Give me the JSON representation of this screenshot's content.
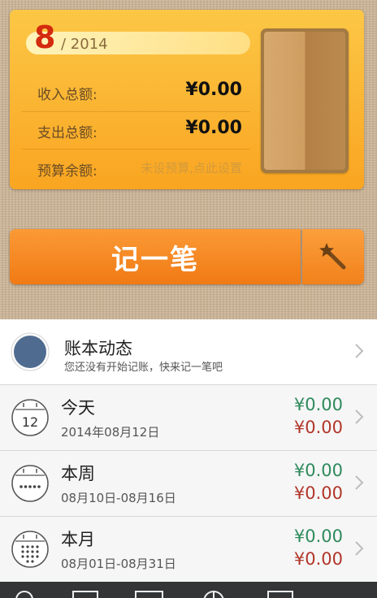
{
  "summary": {
    "month": "8",
    "year": "/ 2014",
    "income_label": "收入总额:",
    "income_value": "¥0.00",
    "expense_label": "支出总额:",
    "expense_value": "¥0.00",
    "budget_label": "预算余额:",
    "budget_hint": "未设预算,点此设置"
  },
  "record": {
    "label": "记一笔",
    "wand_icon": "magic-wand-icon"
  },
  "list": {
    "dynamics": {
      "title": "账本动态",
      "subtitle": "您还没有开始记账，快来记一笔吧"
    },
    "today": {
      "title": "今天",
      "date": "2014年08月12日",
      "calendar_day": "12",
      "income": "¥0.00",
      "expense": "¥0.00"
    },
    "week": {
      "title": "本周",
      "range": "08月10日-08月16日",
      "income": "¥0.00",
      "expense": "¥0.00"
    },
    "month": {
      "title": "本月",
      "range": "08月01日-08月31日",
      "income": "¥0.00",
      "expense": "¥0.00"
    }
  },
  "colors": {
    "income": "#2e8a5c",
    "expense": "#b1362a",
    "accent": "#f07a14"
  }
}
